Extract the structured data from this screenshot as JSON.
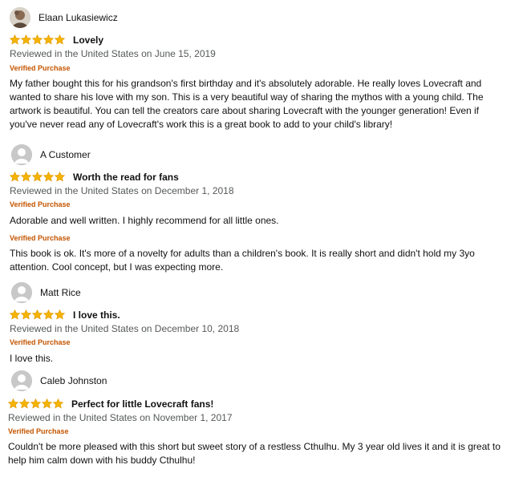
{
  "colors": {
    "star": "#f4b400",
    "star_outline": "#e39c00",
    "verified": "#c45500",
    "meta": "#565959",
    "text": "#111111",
    "avatar_bg": "#c8c8c8"
  },
  "reviews": [
    {
      "reviewer": "Elaan Lukasiewicz",
      "avatar": "photo-avatar",
      "rating": 5,
      "title": "Lovely",
      "date": "Reviewed in the United States on June 15, 2019",
      "verified": "Verified Purchase",
      "body": "My father bought this for his grandson's first birthday and it's absolutely adorable. He really loves Lovecraft and wanted to share his love with my son. This is a very beautiful way of sharing the mythos with a young child. The artwork is beautiful. You can tell the creators care about sharing Lovecraft with the younger generation! Even if you've never read any of Lovecraft's work this is a great book to add to your child's library!"
    },
    {
      "reviewer": "A Customer",
      "avatar": "default-user-avatar",
      "rating": 5,
      "title": "Worth the read for fans",
      "date": "Reviewed in the United States on December 1, 2018",
      "verified": "Verified Purchase",
      "body": "Adorable and well written. I highly recommend for all little ones.",
      "extra_verified": "Verified Purchase",
      "extra_body": "This book is ok. It's more of a novelty for adults than a children's book. It is really short and didn't hold my 3yo attention. Cool concept, but I was expecting more."
    },
    {
      "reviewer": "Matt Rice",
      "avatar": "default-user-avatar",
      "rating": 5,
      "title": "I love this.",
      "date": "Reviewed in the United States on December 10, 2018",
      "verified": "Verified Purchase",
      "body": "I love this."
    },
    {
      "reviewer": "Caleb Johnston",
      "avatar": "default-user-avatar",
      "rating": 5,
      "title": "Perfect for little Lovecraft fans!",
      "date": "Reviewed in the United States on November 1, 2017",
      "verified": "Verified Purchase",
      "body": "Couldn't be more pleased with this short but sweet story of a restless Cthulhu. My 3 year old lives it and it is great to help him calm down with his buddy Cthulhu!"
    }
  ]
}
